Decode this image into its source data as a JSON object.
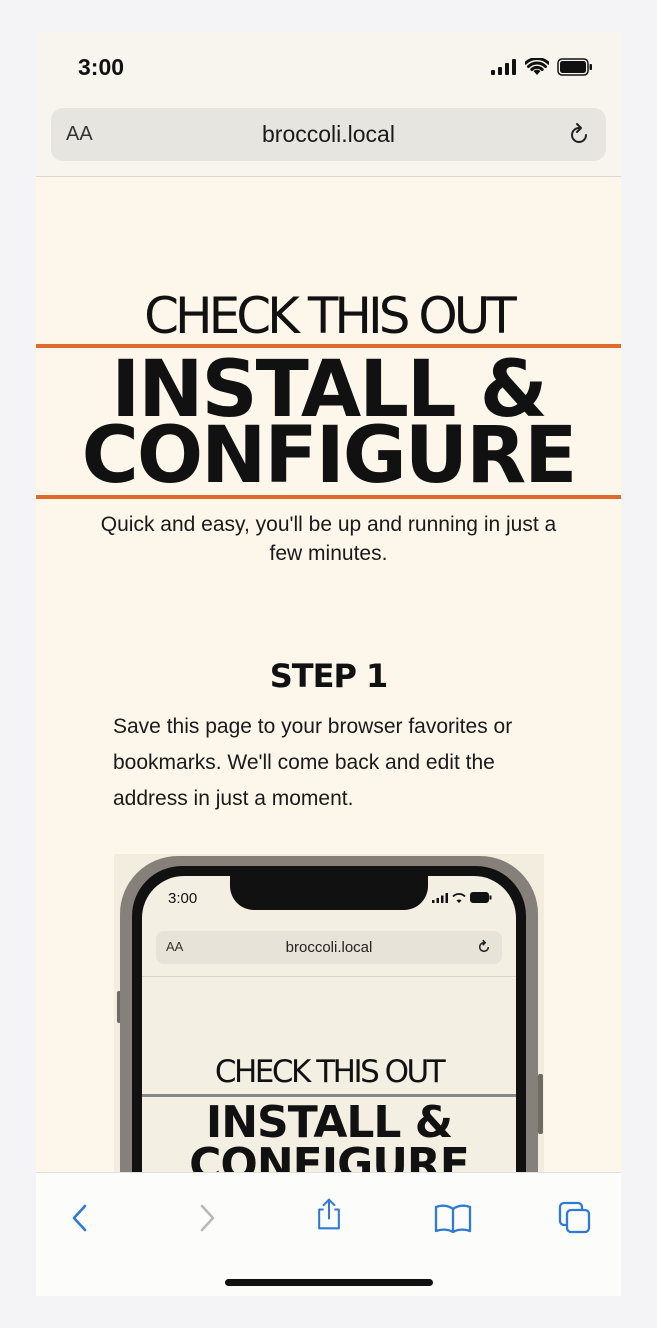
{
  "status_bar": {
    "time": "3:00"
  },
  "browser": {
    "text_size_label": "AA",
    "address": "broccoli.local"
  },
  "page": {
    "kicker": "CHECK THIS OUT",
    "headline_line1": "INSTALL &",
    "headline_line2": "CONFIGURE",
    "subtitle": "Quick and easy, you'll be up and running in just a few minutes.",
    "step_title": "STEP 1",
    "step_body": "Save this page to your browser favorites or bookmarks. We'll come back and edit the address in just a moment."
  },
  "illustration": {
    "time": "3:00",
    "text_size_label": "AA",
    "address": "broccoli.local",
    "kicker": "CHECK THIS OUT",
    "headline_line1": "INSTALL &",
    "headline_line2": "CONFIGURE"
  },
  "toolbar": {
    "icons": [
      "back-icon",
      "forward-icon",
      "share-icon",
      "bookmarks-icon",
      "tabs-icon"
    ]
  },
  "colors": {
    "accent_rule": "#e06a2c",
    "page_background": "#fcf6eb",
    "toolbar_tint": "#2f7ad6"
  }
}
